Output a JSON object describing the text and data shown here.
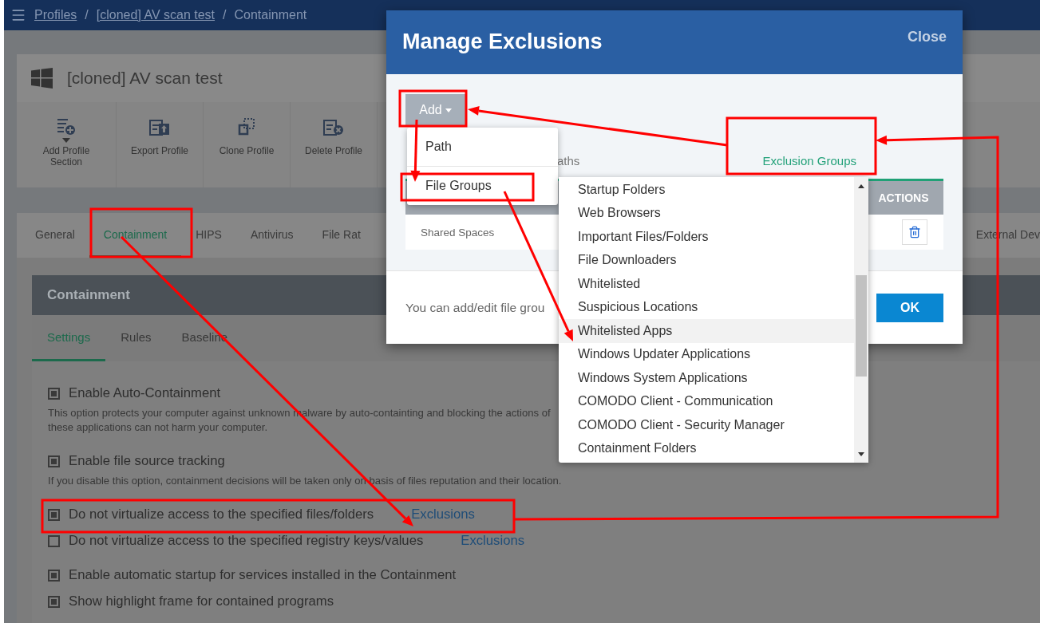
{
  "breadcrumb": {
    "items": [
      "Profiles",
      "[cloned] AV scan test",
      "Containment"
    ],
    "separator": "/"
  },
  "profile": {
    "title": "[cloned] AV scan test"
  },
  "toolbar": [
    {
      "label": "Add Profile Section",
      "kind": "add",
      "has_menu": true
    },
    {
      "label": "Export Profile",
      "kind": "export",
      "has_menu": false
    },
    {
      "label": "Clone Profile",
      "kind": "clone",
      "has_menu": false
    },
    {
      "label": "Delete Profile",
      "kind": "delete",
      "has_menu": false
    }
  ],
  "tabs": [
    {
      "label": "General",
      "selected": false
    },
    {
      "label": "Containment",
      "selected": true
    },
    {
      "label": "HIPS",
      "selected": false
    },
    {
      "label": "Antivirus",
      "selected": false
    },
    {
      "label": "File Rat",
      "selected": false
    },
    {
      "label": "External Dev",
      "selected": false
    }
  ],
  "panel": {
    "title": "Containment",
    "subtabs": [
      {
        "label": "Settings",
        "selected": true
      },
      {
        "label": "Rules",
        "selected": false
      },
      {
        "label": "Baseline",
        "selected": false
      }
    ],
    "option_groups": [
      [
        {
          "label": "Enable Auto-Containment",
          "checked": true,
          "description_lines": [
            "This option protects your computer against unknown malware by auto-containting and blocking the actions of",
            "these applications can not harm your computer."
          ]
        }
      ],
      [
        {
          "label": "Enable file source tracking",
          "checked": true,
          "description_lines": [
            "If you disable this option, containment decisions will be taken only on basis of files reputation and their location."
          ]
        }
      ],
      [
        {
          "label": "Do not virtualize access to the specified files/folders",
          "checked": true,
          "link": "Exclusions"
        },
        {
          "label": "Do not virtualize access to the specified registry keys/values",
          "checked": false,
          "link": "Exclusions"
        }
      ],
      [
        {
          "label": "Enable automatic startup for services installed in the Containment",
          "checked": true
        },
        {
          "label": "Show highlight frame for contained programs",
          "checked": true
        }
      ]
    ]
  },
  "modal": {
    "title": "Manage Exclusions",
    "close": "Close",
    "add_button": "Add",
    "add_menu": [
      "Path",
      "File Groups"
    ],
    "tabs": [
      {
        "label": "aths",
        "selected": false
      },
      {
        "label": "Exclusion Groups",
        "selected": true
      }
    ],
    "table": {
      "columns": [
        "ACTIONS"
      ],
      "rows": [
        {
          "column_1": "Shared Spaces"
        }
      ]
    },
    "footer_text": "You can add/edit file grou",
    "ok_button": "OK"
  },
  "file_groups_list": {
    "items": [
      {
        "label": "Startup Folders",
        "selected": false
      },
      {
        "label": "Web Browsers",
        "selected": false
      },
      {
        "label": "Important Files/Folders",
        "selected": false
      },
      {
        "label": "File Downloaders",
        "selected": false
      },
      {
        "label": "Whitelisted",
        "selected": false
      },
      {
        "label": "Suspicious Locations",
        "selected": false
      },
      {
        "label": "Whitelisted Apps",
        "selected": true
      },
      {
        "label": "Windows Updater Applications",
        "selected": false
      },
      {
        "label": "Windows System Applications",
        "selected": false
      },
      {
        "label": "COMODO Client - Communication",
        "selected": false
      },
      {
        "label": "COMODO Client - Security Manager",
        "selected": false
      },
      {
        "label": "Containment Folders",
        "selected": false
      }
    ]
  }
}
